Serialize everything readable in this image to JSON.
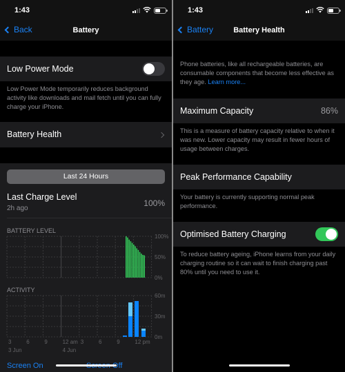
{
  "status_bar": {
    "time": "1:43"
  },
  "left": {
    "nav": {
      "back_label": "Back",
      "title": "Battery"
    },
    "low_power_mode": {
      "label": "Low Power Mode",
      "enabled": false,
      "footnote": "Low Power Mode temporarily reduces background activity like downloads and mail fetch until you can fully charge your iPhone."
    },
    "battery_health_label": "Battery Health",
    "segment_label": "Last 24 Hours",
    "last_charge": {
      "label": "Last Charge Level",
      "sublabel": "2h ago",
      "value": "100%"
    },
    "legend": {
      "screen_on": "Screen On",
      "screen_off": "Screen Off"
    }
  },
  "right": {
    "nav": {
      "back_label": "Battery",
      "title": "Battery Health"
    },
    "intro": "Phone batteries, like all rechargeable batteries, are consumable components that become less effective as they age.",
    "learn_more": "Learn more...",
    "max_capacity": {
      "label": "Maximum Capacity",
      "value": "86%",
      "footnote": "This is a measure of battery capacity relative to when it was new. Lower capacity may result in fewer hours of usage between charges."
    },
    "peak_performance": {
      "label": "Peak Performance Capability",
      "footnote": "Your battery is currently supporting normal peak performance."
    },
    "optimised_charging": {
      "label": "Optimised Battery Charging",
      "enabled": true,
      "footnote": "To reduce battery ageing, iPhone learns from your daily charging routine so it can wait to finish charging past 80% until you need to use it."
    }
  },
  "colors": {
    "accent": "#1a82f5",
    "green": "#32c759",
    "battery_bar": "#34c759",
    "screen_on": "#0a84ff",
    "screen_off": "#64c8ff"
  },
  "chart_data": [
    {
      "type": "bar",
      "title": "BATTERY LEVEL",
      "ylabel": "",
      "ylim": [
        0,
        100
      ],
      "yticks": [
        "100%",
        "50%",
        "0%"
      ],
      "x_hours": [
        20.5,
        21.0,
        21.5,
        22.0,
        22.5,
        23.0,
        23.5,
        24.0,
        24.5,
        25.0,
        25.5,
        26.0,
        26.5
      ],
      "values": [
        100,
        97,
        92,
        88,
        84,
        80,
        76,
        71,
        67,
        62,
        58,
        55,
        54
      ]
    },
    {
      "type": "bar",
      "title": "ACTIVITY",
      "ylim": [
        0,
        60
      ],
      "yticks": [
        "60m",
        "30m",
        "0m"
      ],
      "xticks": [
        "3",
        "6",
        "9",
        "12 am",
        "3",
        "6",
        "9",
        "12 pm"
      ],
      "xdates": [
        "3 Jun",
        "4 Jun"
      ],
      "categories_hour": [
        22,
        23,
        24,
        25
      ],
      "series": [
        {
          "name": "Screen On",
          "values": [
            2,
            30,
            52,
            9
          ]
        },
        {
          "name": "Screen Off",
          "values": [
            0,
            20,
            0,
            3
          ]
        }
      ]
    }
  ]
}
